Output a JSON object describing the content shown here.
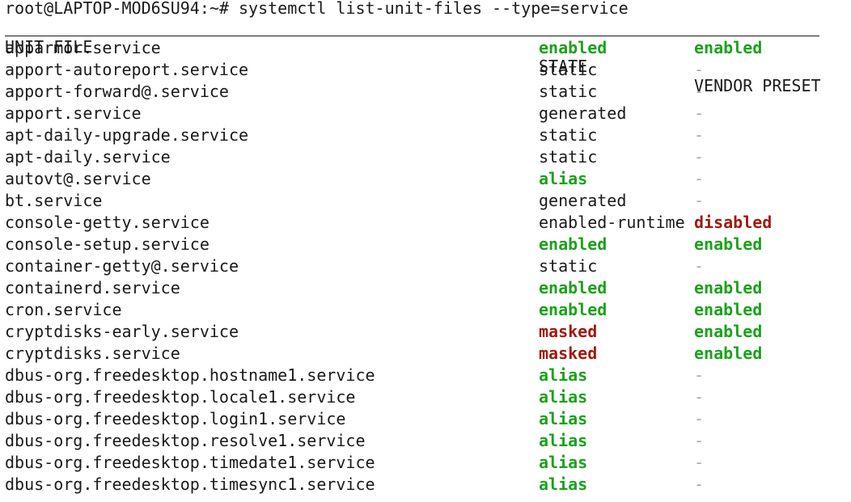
{
  "prompt": "root@LAPTOP-MOD6SU94:~# systemctl list-unit-files --type=service",
  "headers": {
    "unit_file": "UNIT FILE",
    "state": "STATE",
    "vendor_preset": "VENDOR PRESET"
  },
  "rows": [
    {
      "unit": "apparmor.service",
      "state": "enabled",
      "preset": "enabled"
    },
    {
      "unit": "apport-autoreport.service",
      "state": "static",
      "preset": "-"
    },
    {
      "unit": "apport-forward@.service",
      "state": "static",
      "preset": "-"
    },
    {
      "unit": "apport.service",
      "state": "generated",
      "preset": "-"
    },
    {
      "unit": "apt-daily-upgrade.service",
      "state": "static",
      "preset": "-"
    },
    {
      "unit": "apt-daily.service",
      "state": "static",
      "preset": "-"
    },
    {
      "unit": "autovt@.service",
      "state": "alias",
      "preset": "-"
    },
    {
      "unit": "bt.service",
      "state": "generated",
      "preset": "-"
    },
    {
      "unit": "console-getty.service",
      "state": "enabled-runtime",
      "preset": "disabled"
    },
    {
      "unit": "console-setup.service",
      "state": "enabled",
      "preset": "enabled"
    },
    {
      "unit": "container-getty@.service",
      "state": "static",
      "preset": "-"
    },
    {
      "unit": "containerd.service",
      "state": "enabled",
      "preset": "enabled"
    },
    {
      "unit": "cron.service",
      "state": "enabled",
      "preset": "enabled"
    },
    {
      "unit": "cryptdisks-early.service",
      "state": "masked",
      "preset": "enabled"
    },
    {
      "unit": "cryptdisks.service",
      "state": "masked",
      "preset": "enabled"
    },
    {
      "unit": "dbus-org.freedesktop.hostname1.service",
      "state": "alias",
      "preset": "-"
    },
    {
      "unit": "dbus-org.freedesktop.locale1.service",
      "state": "alias",
      "preset": "-"
    },
    {
      "unit": "dbus-org.freedesktop.login1.service",
      "state": "alias",
      "preset": "-"
    },
    {
      "unit": "dbus-org.freedesktop.resolve1.service",
      "state": "alias",
      "preset": "-"
    },
    {
      "unit": "dbus-org.freedesktop.timedate1.service",
      "state": "alias",
      "preset": "-"
    },
    {
      "unit": "dbus-org.freedesktop.timesync1.service",
      "state": "alias",
      "preset": "-"
    }
  ],
  "colors": {
    "enabled": "#1aa21a",
    "alias": "#1aa21a",
    "masked": "#a01a10",
    "disabled": "#a01a10",
    "dash": "#a8a8a8",
    "text": "#1a1a1a"
  }
}
